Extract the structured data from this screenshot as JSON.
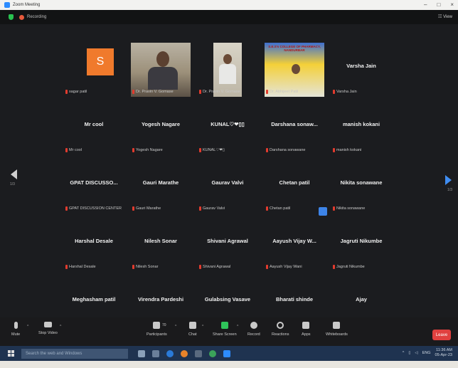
{
  "window": {
    "title": "Zoom Meeting",
    "controls": [
      "–",
      "□",
      "×"
    ]
  },
  "topbar": {
    "recording_label": "Recording",
    "view_label": "View"
  },
  "tiles": [
    {
      "type": "avatar",
      "initial": "S",
      "center": "",
      "label": "sagar patil"
    },
    {
      "type": "video",
      "center": "",
      "label": "Dr. Pravin V. Gomase"
    },
    {
      "type": "video",
      "center": "",
      "label": "Dr. Pravin V. Gomase"
    },
    {
      "type": "poster",
      "center": "",
      "label": "Dr. Abhijeet Patil",
      "poster_title": "S.E.S's COLLEGE OF PHARMACY, NANDURBAR"
    },
    {
      "type": "name",
      "center": "Varsha Jain",
      "label": "Varsha Jain"
    },
    {
      "type": "name",
      "center": "Mr cool",
      "label": "Mr cool"
    },
    {
      "type": "name",
      "center": "Yogesh Nagare",
      "label": "Yogesh Nagare"
    },
    {
      "type": "name",
      "center": "KUNAL♡❤▯▯",
      "label": "KUNAL♡❤▯"
    },
    {
      "type": "name",
      "center": "Darshana sonaw...",
      "label": "Darshana sonawane"
    },
    {
      "type": "name",
      "center": "manish kokani",
      "label": "manish kokani"
    },
    {
      "type": "name",
      "center": "GPAT DISCUSSO...",
      "label": "GPAT DISCUSSION CENTER"
    },
    {
      "type": "name",
      "center": "Gauri Marathe",
      "label": "Gauri Marathe"
    },
    {
      "type": "name",
      "center": "Gaurav Valvi",
      "label": "Gaurav Valvi"
    },
    {
      "type": "name",
      "center": "Chetan patil",
      "label": "Chetan patil"
    },
    {
      "type": "name",
      "center": "Nikita sonawane",
      "label": "Nikita sonawane"
    },
    {
      "type": "name",
      "center": "Harshal Desale",
      "label": "Harshal Desale"
    },
    {
      "type": "name",
      "center": "Nilesh Sonar",
      "label": "Nilesh Sonar"
    },
    {
      "type": "name",
      "center": "Shivani Agrawal",
      "label": "Shivani Agrawal"
    },
    {
      "type": "name",
      "center": "Aayush Vijay W...",
      "label": "Aayush Vijay Wani"
    },
    {
      "type": "name",
      "center": "Jagruti Nikumbe",
      "label": "Jagruti Nikumbe"
    },
    {
      "type": "name",
      "center": "Meghasham patil",
      "label": "Meghasham patil"
    },
    {
      "type": "name",
      "center": "Virendra Pardeshi",
      "label": "Virendra Pardeshi"
    },
    {
      "type": "name",
      "center": "Gulabsing Vasave",
      "label": "Gulabsing Vasave"
    },
    {
      "type": "name",
      "center": "Bharati shinde",
      "label": "Bharati shinde"
    },
    {
      "type": "name",
      "center": "Ajay",
      "label": "Ajay"
    }
  ],
  "pager": {
    "left": "1/3",
    "right": "1/3"
  },
  "toolbar": {
    "mute": "Mute",
    "stop_video": "Stop Video",
    "participants": "Participants",
    "participants_count": "70",
    "chat": "Chat",
    "share_screen": "Share Screen",
    "record": "Record",
    "reactions": "Reactions",
    "apps": "Apps",
    "whiteboards": "Whiteboards",
    "leave": "Leave"
  },
  "taskbar": {
    "search_placeholder": "Search the web and Windows",
    "language": "ENG",
    "time": "11:36 AM",
    "date": "05-Apr-23"
  },
  "colors": {
    "accent": "#2d8cff",
    "leave": "#e0403f",
    "share_green": "#2fc35a",
    "avatar_orange": "#f07a2c"
  }
}
